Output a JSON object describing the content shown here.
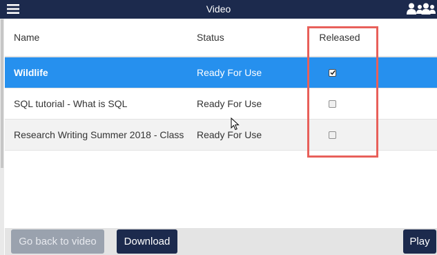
{
  "header": {
    "title": "Video",
    "menu_icon": "hamburger-menu-icon",
    "user_icon": "user-icon",
    "group_icon": "users-group-icon"
  },
  "table": {
    "columns": {
      "name": "Name",
      "status": "Status",
      "released": "Released"
    },
    "rows": [
      {
        "name": "Wildlife",
        "status": "Ready For Use",
        "released": true,
        "selected": true
      },
      {
        "name": "SQL tutorial - What is SQL",
        "status": "Ready For Use",
        "released": false,
        "selected": false
      },
      {
        "name": "Research Writing Summer 2018 - Class",
        "status": "Ready For Use",
        "released": false,
        "selected": false
      }
    ]
  },
  "footer": {
    "back_label": "Go back to video",
    "download_label": "Download",
    "play_label": "Play"
  },
  "colors": {
    "navbar": "#1c2a4d",
    "selected_row": "#2690ee",
    "highlight_box": "#e8605a",
    "disabled_button": "#9aa2ae"
  }
}
